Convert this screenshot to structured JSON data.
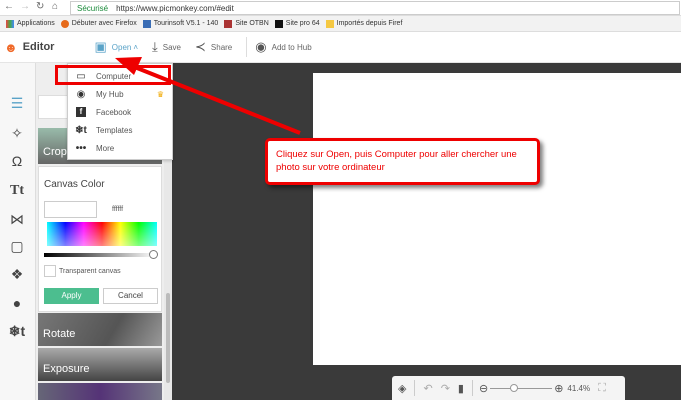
{
  "browser": {
    "secure_label": "Sécurisé",
    "url": "https://www.picmonkey.com/#edit",
    "bookmarks": [
      "Applications",
      "Débuter avec Firefox",
      "Tourinsoft V5.1 - 140",
      "Site OTBN",
      "Site pro 64",
      "Importés depuis Firef"
    ]
  },
  "toolbar": {
    "app_name": "Editor",
    "open": "Open",
    "save": "Save",
    "share": "Share",
    "add_to_hub": "Add to Hub"
  },
  "open_menu": {
    "items": [
      "Computer",
      "My Hub",
      "Facebook",
      "Templates",
      "More"
    ]
  },
  "panel": {
    "tiles": [
      "Crop",
      "Rotate",
      "Exposure"
    ],
    "canvas_color_title": "Canvas Color",
    "hex_value": "ffffff",
    "transparent_label": "Transparent canvas",
    "apply": "Apply",
    "cancel": "Cancel"
  },
  "callout": {
    "text": "Cliquez sur Open, puis Computer pour aller chercher une photo sur votre ordinateur"
  },
  "bottom_bar": {
    "zoom_level": "41.4%"
  },
  "colors": {
    "accent": "#4cbe8f",
    "annotation": "#e00000",
    "brand": "#f06a2a",
    "canvas_bg": "#3a3a3a"
  }
}
